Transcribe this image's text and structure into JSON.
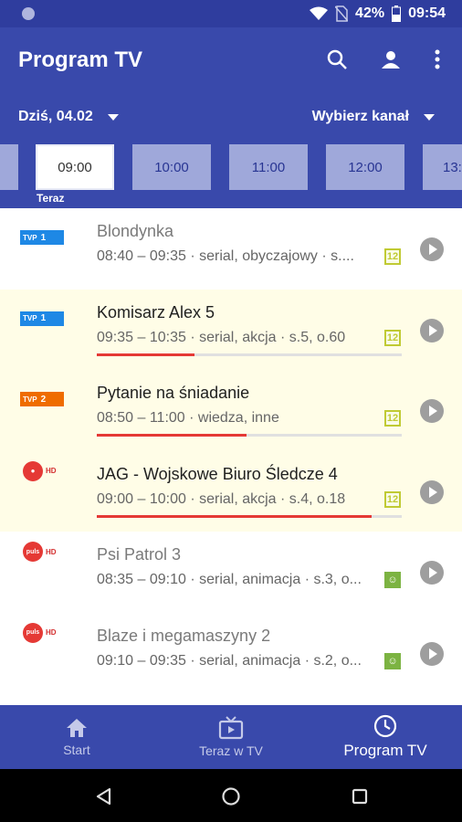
{
  "status": {
    "battery": "42%",
    "time": "09:54"
  },
  "header": {
    "title": "Program TV"
  },
  "filters": {
    "date": "Dziś, 04.02",
    "channel": "Wybierz kanał"
  },
  "timeline": {
    "now_label": "Teraz",
    "slots": [
      "09:00",
      "10:00",
      "11:00",
      "12:00",
      "13:"
    ]
  },
  "programs": [
    {
      "channel": "TVP1",
      "title": "Blondynka",
      "meta": "08:40 – 09:35 · serial, obyczajowy · s....",
      "rating": "12",
      "live": false,
      "progress": 0
    },
    {
      "channel": "TVP1",
      "title": "Komisarz Alex 5",
      "meta": "09:35 – 10:35 · serial, akcja · s.5, o.60",
      "rating": "12",
      "live": true,
      "progress": 0.32
    },
    {
      "channel": "TVP2",
      "title": "Pytanie na śniadanie",
      "meta": "08:50 – 11:00 · wiedza, inne",
      "rating": "12",
      "live": true,
      "progress": 0.49
    },
    {
      "channel": "Polsat HD",
      "title": "JAG - Wojskowe Biuro Śledcze 4",
      "meta": "09:00 – 10:00 · serial, akcja · s.4, o.18",
      "rating": "12",
      "live": true,
      "progress": 0.9
    },
    {
      "channel": "Puls HD",
      "title": "Psi Patrol 3",
      "meta": "08:35 – 09:10 · serial, animacja · s.3, o...",
      "rating": "kids",
      "live": false,
      "progress": 0
    },
    {
      "channel": "Puls HD",
      "title": "Blaze i megamaszyny 2",
      "meta": "09:10 – 09:35 · serial, animacja · s.2, o...",
      "rating": "kids",
      "live": false,
      "progress": 0
    }
  ],
  "bottom_nav": [
    {
      "label": "Start",
      "icon": "home-icon"
    },
    {
      "label": "Teraz w TV",
      "icon": "tv-icon"
    },
    {
      "label": "Program TV",
      "icon": "clock-icon"
    }
  ],
  "colors": {
    "primary": "#3949ab",
    "status_bar": "#2f3d9e",
    "live_bg": "#fffde7",
    "progress": "#e53935"
  }
}
